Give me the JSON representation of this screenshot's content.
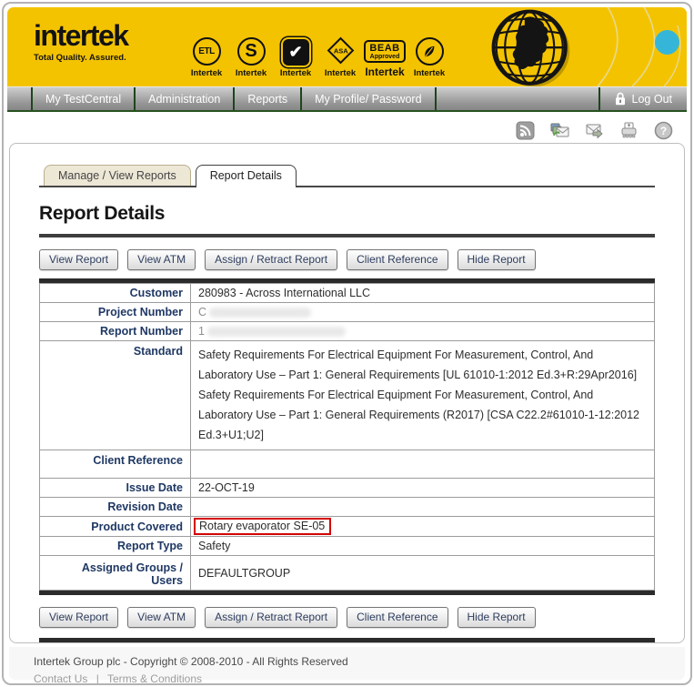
{
  "brand": {
    "logo": "intertek",
    "tagline": "Total Quality. Assured.",
    "yellow": "#F4C300",
    "cyan_dot": "#35B6D9",
    "cert_marks": [
      {
        "name": "etl-certification-mark",
        "glyph": "ETL",
        "caption": "Intertek"
      },
      {
        "name": "s-certification-mark",
        "glyph": "S",
        "caption": "Intertek"
      },
      {
        "name": "quality-performance-check-mark",
        "glyph": "✔",
        "caption": "Intertek"
      },
      {
        "name": "asa-certification-mark",
        "glyph": "ASA",
        "caption": "Intertek"
      },
      {
        "name": "beab-approved-mark",
        "line1": "BEAB",
        "line2": "Approved",
        "caption": "Intertek"
      },
      {
        "name": "leaf-certification-mark",
        "caption": "Intertek"
      }
    ]
  },
  "nav": {
    "items": [
      "My TestCentral",
      "Administration",
      "Reports",
      "My Profile/ Password"
    ],
    "logout_label": "Log Out"
  },
  "toolbar": {
    "icons": [
      "rss-icon",
      "share-report-icon",
      "send-report-icon",
      "print-icon",
      "help-icon"
    ]
  },
  "tabs": [
    {
      "label": "Manage / View Reports",
      "active": false
    },
    {
      "label": "Report Details",
      "active": true
    }
  ],
  "page_title": "Report Details",
  "actions": [
    "View Report",
    "View ATM",
    "Assign / Retract Report",
    "Client Reference",
    "Hide Report"
  ],
  "report": {
    "customer_label": "Customer",
    "customer": "280983 - Across International LLC",
    "project_number_label": "Project Number",
    "project_number_visible_prefix": "C",
    "project_number_redacted": true,
    "report_number_label": "Report Number",
    "report_number_visible_prefix": "1",
    "report_number_redacted": true,
    "standard_label": "Standard",
    "standard_lines": [
      "Safety Requirements For Electrical Equipment For Measurement, Control, And Laboratory Use – Part 1: General Requirements [UL 61010-1:2012 Ed.3+R:29Apr2016]",
      "Safety Requirements For Electrical Equipment For Measurement, Control, And Laboratory Use – Part 1: General Requirements (R2017) [CSA C22.2#61010-1-12:2012 Ed.3+U1;U2]"
    ],
    "client_reference_label": "Client Reference",
    "client_reference": "",
    "issue_date_label": "Issue Date",
    "issue_date": "22-OCT-19",
    "revision_date_label": "Revision Date",
    "revision_date": "",
    "product_covered_label": "Product Covered",
    "product_covered": "Rotary evaporator SE-05",
    "product_covered_highlight_color": "#d40000",
    "report_type_label": "Report Type",
    "report_type": "Safety",
    "assigned_groups_label": "Assigned Groups / Users",
    "assigned_groups": "DEFAULTGROUP"
  },
  "footer": {
    "line1": "Intertek Group plc - Copyright © 2008-2010 - All Rights Reserved",
    "links": [
      "Contact Us",
      "Terms & Conditions"
    ],
    "separator": "|"
  }
}
